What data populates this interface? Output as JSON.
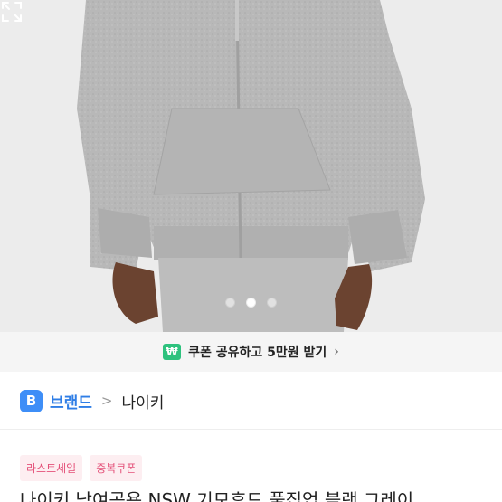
{
  "product_image": {
    "carousel": {
      "count": 3,
      "active_index": 1
    },
    "expand_icon": "expand-icon"
  },
  "coupon_banner": {
    "badge": "₩",
    "text": "쿠폰 공유하고 5만원 받기",
    "chevron": "›"
  },
  "breadcrumb": {
    "badge": "B",
    "brand_label": "브랜드",
    "separator": ">",
    "brand_name": "나이키"
  },
  "tags": [
    "라스트세일",
    "중복쿠폰"
  ],
  "product_title": "나이키 남여공용 NSW 기모후드 풀집업 블랙 그레이",
  "colors": {
    "accent_blue": "#3e8ef7",
    "coupon_green": "#2ec27e",
    "tag_pink": "#e4527a"
  }
}
